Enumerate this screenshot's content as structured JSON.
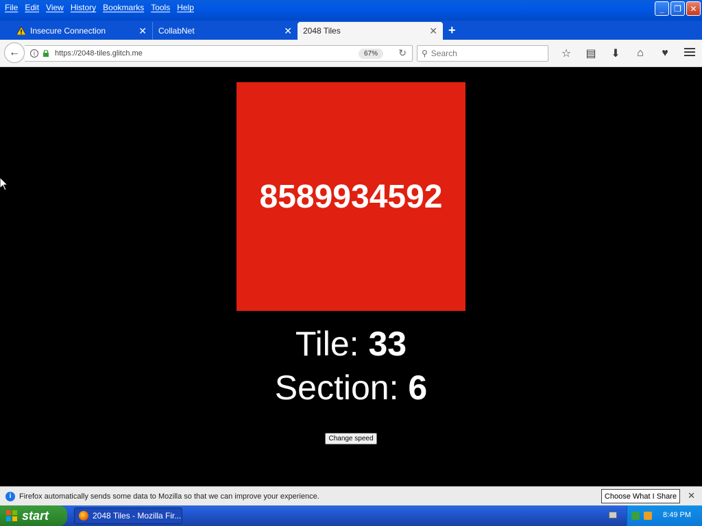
{
  "menu": [
    "File",
    "Edit",
    "View",
    "History",
    "Bookmarks",
    "Tools",
    "Help"
  ],
  "tabs": [
    {
      "label": "Insecure Connection",
      "icon": "warning-icon"
    },
    {
      "label": "CollabNet"
    },
    {
      "label": "2048 Tiles",
      "active": true
    }
  ],
  "url": "https://2048-tiles.glitch.me",
  "zoom": "67%",
  "search_placeholder": "Search",
  "page": {
    "tile_value": "8589934592",
    "tile_color": "#e02010",
    "tile_label": "Tile:",
    "tile_number": "33",
    "section_label": "Section:",
    "section_number": "6",
    "change_speed": "Change speed"
  },
  "notification": {
    "text": "Firefox automatically sends some data to Mozilla so that we can improve your experience.",
    "button": "Choose What I Share"
  },
  "taskbar": {
    "start": "start",
    "item": "2048 Tiles - Mozilla Fir...",
    "clock": "8:49 PM"
  }
}
